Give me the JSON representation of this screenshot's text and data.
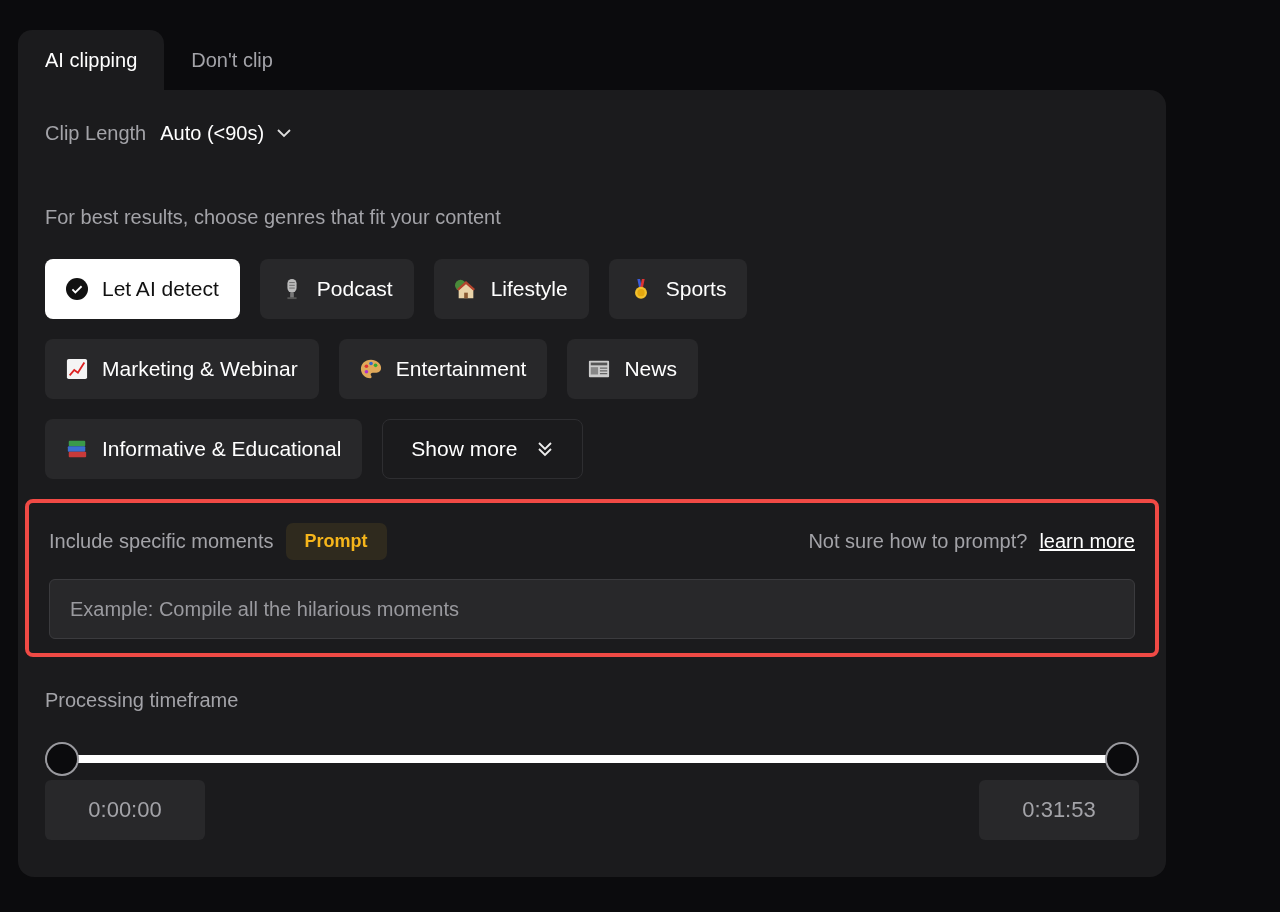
{
  "tabs": [
    {
      "label": "AI clipping",
      "selected": true
    },
    {
      "label": "Don't clip",
      "selected": false
    }
  ],
  "clip_length": {
    "label": "Clip Length",
    "value": "Auto (<90s)"
  },
  "genres": {
    "hint": "For best results, choose genres that fit your content",
    "items": [
      {
        "label": "Let AI detect",
        "kind": "check",
        "selected": true
      },
      {
        "label": "Podcast",
        "kind": "microphone",
        "selected": false
      },
      {
        "label": "Lifestyle",
        "kind": "house",
        "selected": false
      },
      {
        "label": "Sports",
        "kind": "medal",
        "selected": false
      },
      {
        "label": "Marketing & Webinar",
        "kind": "chart",
        "selected": false
      },
      {
        "label": "Entertainment",
        "kind": "palette",
        "selected": false
      },
      {
        "label": "News",
        "kind": "newspaper",
        "selected": false
      },
      {
        "label": "Informative & Educational",
        "kind": "books",
        "selected": false
      }
    ],
    "show_more": "Show more"
  },
  "moments": {
    "highlighted": true,
    "label": "Include specific moments",
    "badge": "Prompt",
    "help": "Not sure how to prompt?",
    "link": "learn more",
    "placeholder": "Example: Compile all the hilarious moments"
  },
  "timeframe": {
    "label": "Processing timeframe",
    "thumbs": [
      {
        "level": 0
      },
      {
        "level": 1
      }
    ],
    "start": "0:00:00",
    "end": "0:31:53"
  }
}
